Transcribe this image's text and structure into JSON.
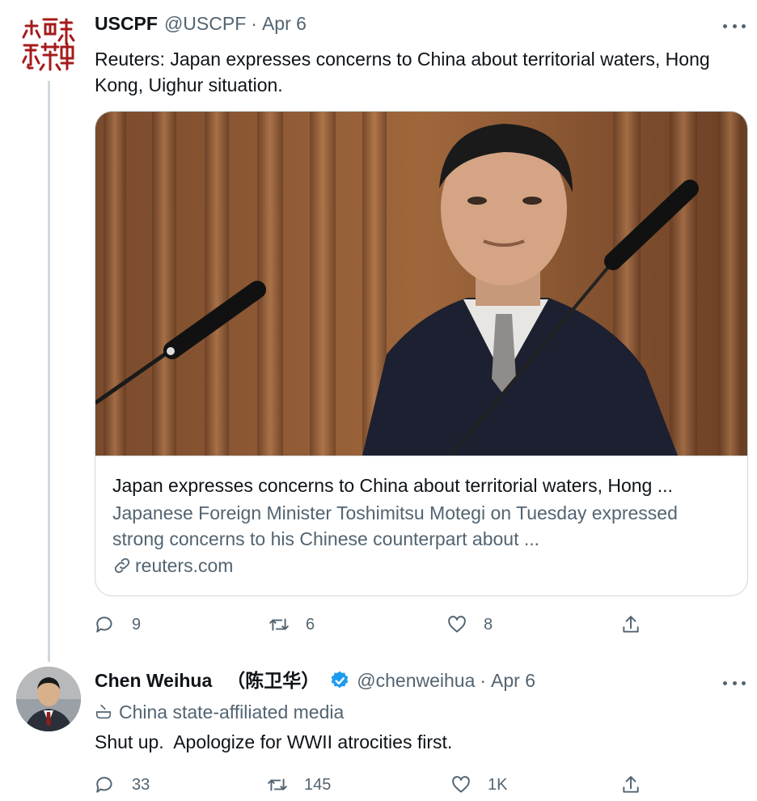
{
  "tweets": [
    {
      "name": "USCPF",
      "handle": "@USCPF",
      "separator": "·",
      "date": "Apr 6",
      "text": "Reuters: Japan expresses concerns to China about territorial waters, Hong Kong, Uighur situation.",
      "card": {
        "title": "Japan expresses concerns to China about territorial waters, Hong ...",
        "description": "Japanese Foreign Minister Toshimitsu Motegi on Tuesday expressed strong concerns to his Chinese counterpart about ...",
        "domain": "reuters.com"
      },
      "stats": {
        "replies": "9",
        "retweets": "6",
        "likes": "8"
      }
    },
    {
      "name": "Chen Weihua",
      "name_cn": "（陈卫华）",
      "handle": "@chenweihua",
      "separator": "·",
      "date": "Apr 6",
      "label": "China state-affiliated media",
      "text": "Shut up.  Apologize for WWII atrocities first.",
      "stats": {
        "replies": "33",
        "retweets": "145",
        "likes": "1K"
      }
    }
  ],
  "colors": {
    "text_primary": "#0f1419",
    "text_secondary": "#536471",
    "border": "#cfd9de",
    "verified_blue": "#1d9bf0",
    "seal_red": "#a61b1b"
  },
  "icons": [
    "reply-icon",
    "retweet-icon",
    "like-icon",
    "share-icon",
    "link-icon",
    "verified-badge-icon",
    "state-media-icon",
    "more-icon"
  ]
}
